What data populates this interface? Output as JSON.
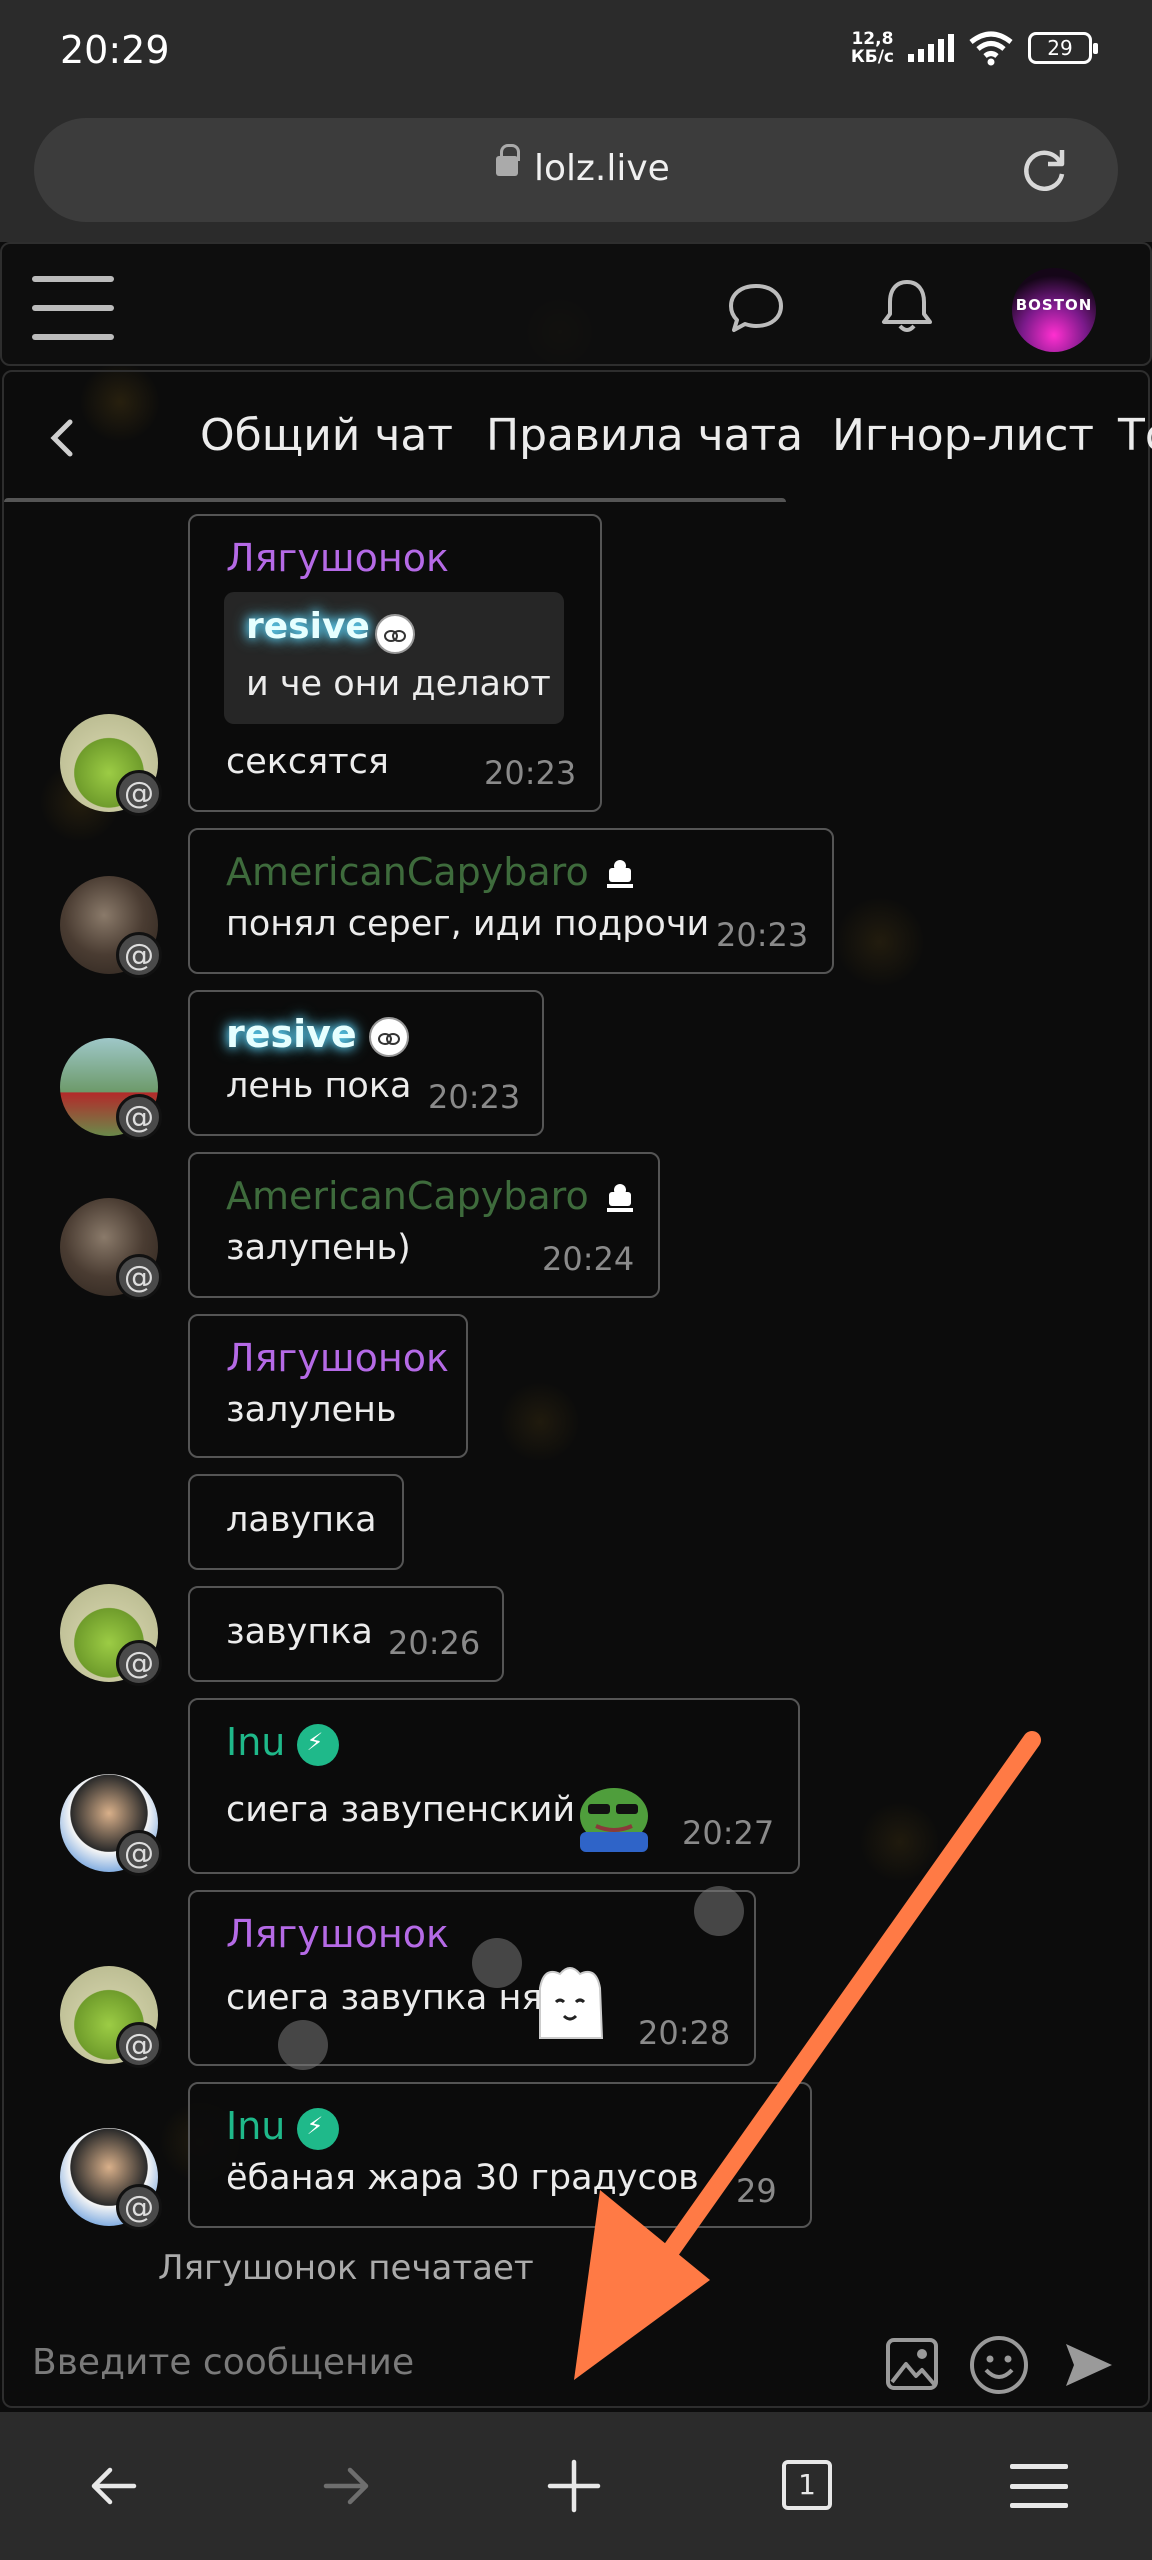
{
  "status_bar": {
    "time": "20:29",
    "speed_value": "12,8",
    "speed_unit": "КБ/с",
    "battery": "29"
  },
  "browser": {
    "url": "lolz.live",
    "tabs_count": "1"
  },
  "forum_header": {
    "avatar_text": "BOSTON"
  },
  "chat": {
    "tabs": [
      "Общий чат",
      "Правила чата",
      "Игнор-лист",
      "То"
    ],
    "messages": [
      {
        "author": "Лягушонок",
        "quote_author": "resive",
        "quote_text": "и че они делают",
        "text": "сексятся",
        "time": "20:23"
      },
      {
        "author": "AmericanCapybaro",
        "text": "понял серег, иди подрочи",
        "time": "20:23"
      },
      {
        "author": "resive",
        "text": "лень пока",
        "time": "20:23"
      },
      {
        "author": "AmericanCapybaro",
        "text": "залупень)",
        "time": "20:24"
      },
      {
        "author": "Лягушонок",
        "text": "залулень"
      },
      {
        "text": "лавупка"
      },
      {
        "text": "завупка",
        "time": "20:26"
      },
      {
        "author": "Inu",
        "text": "сиега завупенский",
        "time": "20:27"
      },
      {
        "author": "Лягушонок",
        "text": "сиега завупка ня",
        "time": "20:28"
      },
      {
        "author": "Inu",
        "text": "ёбаная жара 30 градусов",
        "time": "29"
      }
    ],
    "typing": "Лягушонок печатает",
    "input_placeholder": "Введите сообщение",
    "mention_symbol": "@"
  },
  "colors": {
    "accent_orange": "#ff7a45",
    "name_purple": "#b56ae6",
    "name_teal": "#1fb98a",
    "name_green": "#3e6b3c"
  }
}
